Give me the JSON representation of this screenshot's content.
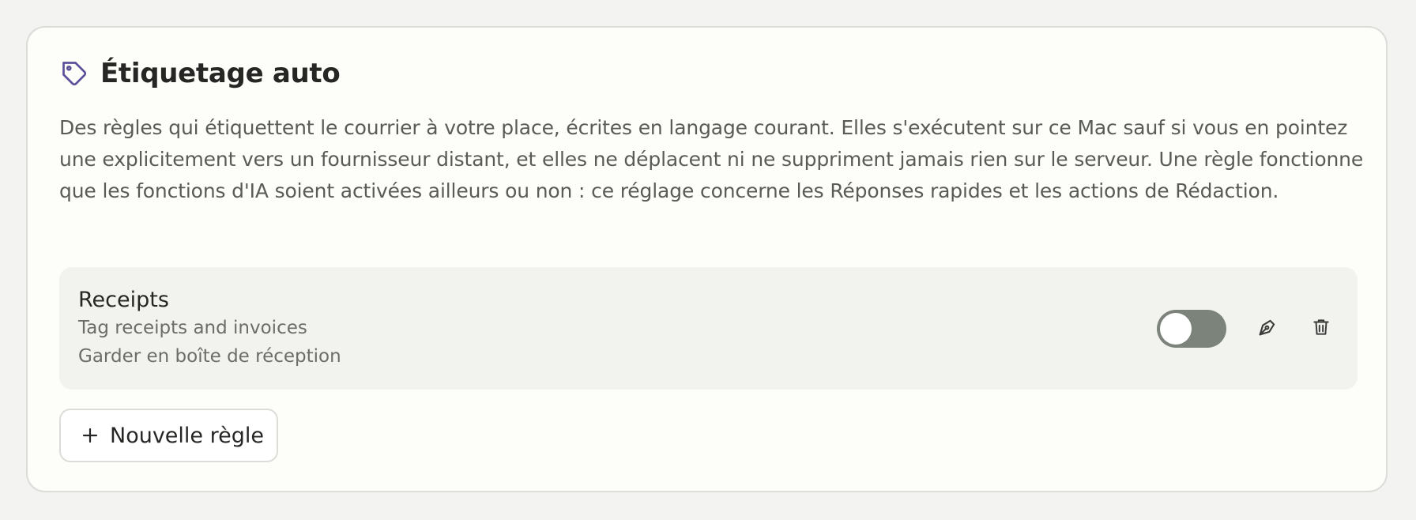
{
  "section": {
    "title": "Étiquetage auto",
    "icon": "tag-icon",
    "description": "Des règles qui étiquettent le courrier à votre place, écrites en langage courant. Elles s'exécutent sur ce Mac sauf si vous en pointez une explicitement vers un fournisseur distant, et elles ne déplacent ni ne suppriment jamais rien sur le serveur. Une règle fonctionne que les fonctions d'IA soient activées ailleurs ou non : ce réglage concerne les Réponses rapides et les actions de Rédaction."
  },
  "rules": [
    {
      "name": "Receipts",
      "description": "Tag receipts and invoices",
      "action": "Garder en boîte de réception",
      "enabled": false,
      "edit_icon": "pen-icon",
      "delete_icon": "trash-icon"
    }
  ],
  "new_rule_button": {
    "label": "Nouvelle règle",
    "icon": "plus-icon"
  },
  "colors": {
    "accent_icon": "#5b4f9a",
    "toggle_off": "#7c837b",
    "card_bg": "#fdfdf9",
    "page_bg": "#f3f3f1"
  }
}
